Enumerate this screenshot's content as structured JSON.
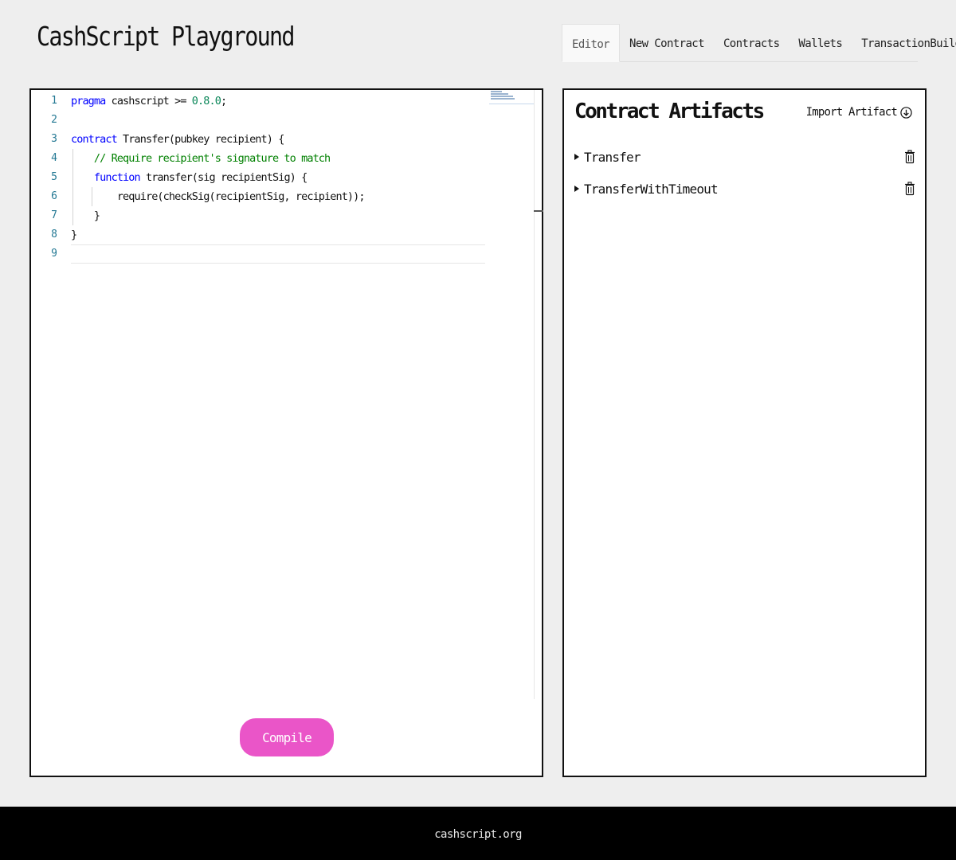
{
  "app": {
    "title": "CashScript Playground"
  },
  "nav": {
    "tabs": [
      {
        "label": "Editor",
        "active": true
      },
      {
        "label": "New Contract",
        "active": false
      },
      {
        "label": "Contracts",
        "active": false
      },
      {
        "label": "Wallets",
        "active": false
      },
      {
        "label": "TransactionBuilder",
        "active": false
      }
    ]
  },
  "editor": {
    "lines": [
      {
        "number": "1",
        "tokens": [
          {
            "t": "kw",
            "v": "pragma"
          },
          {
            "t": "",
            "v": " cashscript >= "
          },
          {
            "t": "num",
            "v": "0.8.0"
          },
          {
            "t": "",
            "v": ";"
          }
        ]
      },
      {
        "number": "2",
        "tokens": []
      },
      {
        "number": "3",
        "tokens": [
          {
            "t": "kw",
            "v": "contract"
          },
          {
            "t": "",
            "v": " Transfer(pubkey recipient) {"
          }
        ]
      },
      {
        "number": "4",
        "tokens": [
          {
            "t": "",
            "v": "    "
          },
          {
            "t": "cm",
            "v": "// Require recipient's signature to match"
          }
        ]
      },
      {
        "number": "5",
        "tokens": [
          {
            "t": "",
            "v": "    "
          },
          {
            "t": "kw",
            "v": "function"
          },
          {
            "t": "",
            "v": " transfer(sig recipientSig) {"
          }
        ]
      },
      {
        "number": "6",
        "tokens": [
          {
            "t": "",
            "v": "        require(checkSig(recipientSig, recipient));"
          }
        ]
      },
      {
        "number": "7",
        "tokens": [
          {
            "t": "",
            "v": "    }"
          }
        ]
      },
      {
        "number": "8",
        "tokens": [
          {
            "t": "",
            "v": "}"
          }
        ]
      },
      {
        "number": "9",
        "tokens": []
      }
    ],
    "compile_label": "Compile",
    "accent": "#ea55c8"
  },
  "artifacts": {
    "title": "Contract Artifacts",
    "import_label": "Import Artifact",
    "import_icon": "arrow-down-circle-icon",
    "items": [
      {
        "name": "Transfer"
      },
      {
        "name": "TransferWithTimeout"
      }
    ]
  },
  "footer": {
    "text": "cashscript.org"
  }
}
